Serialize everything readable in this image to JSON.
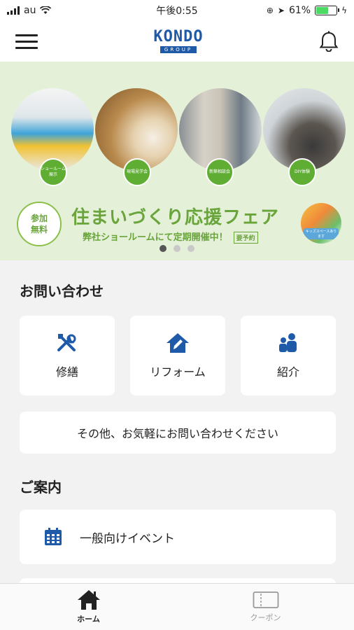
{
  "status_bar": {
    "carrier": "au",
    "time": "午後0:55",
    "battery": "61%",
    "battery_level": 0.61
  },
  "header": {
    "logo_main": "KONDO",
    "logo_sub": "GROUP",
    "menu_icon": "hamburger-icon",
    "notification_icon": "bell-icon"
  },
  "banner": {
    "circle_tags": [
      "ショールーム展示",
      "現場見学会",
      "新築相談会",
      "DIY体験"
    ],
    "badge": "参加\n無料",
    "title": "住まいづくり応援フェア",
    "subtitle": "弊社ショールームにて定期開催中！",
    "reserve": "要予約",
    "kids_label": "キッズスペースあります",
    "page_count": 3,
    "active_page": 1
  },
  "inquiry": {
    "title": "お問い合わせ",
    "tiles": [
      {
        "label": "修繕",
        "icon": "tools-icon"
      },
      {
        "label": "リフォーム",
        "icon": "house-pen-icon"
      },
      {
        "label": "紹介",
        "icon": "people-icon"
      }
    ],
    "other": "その他、お気軽にお問い合わせください"
  },
  "guide": {
    "title": "ご案内",
    "event_label": "一般向けイベント",
    "event_icon": "calendar-icon"
  },
  "tabbar": {
    "home": "ホーム",
    "coupon": "クーポン"
  },
  "colors": {
    "brand_blue": "#1e5aa8",
    "banner_green": "#6aa53c",
    "banner_bg": "#e4f1d8"
  }
}
